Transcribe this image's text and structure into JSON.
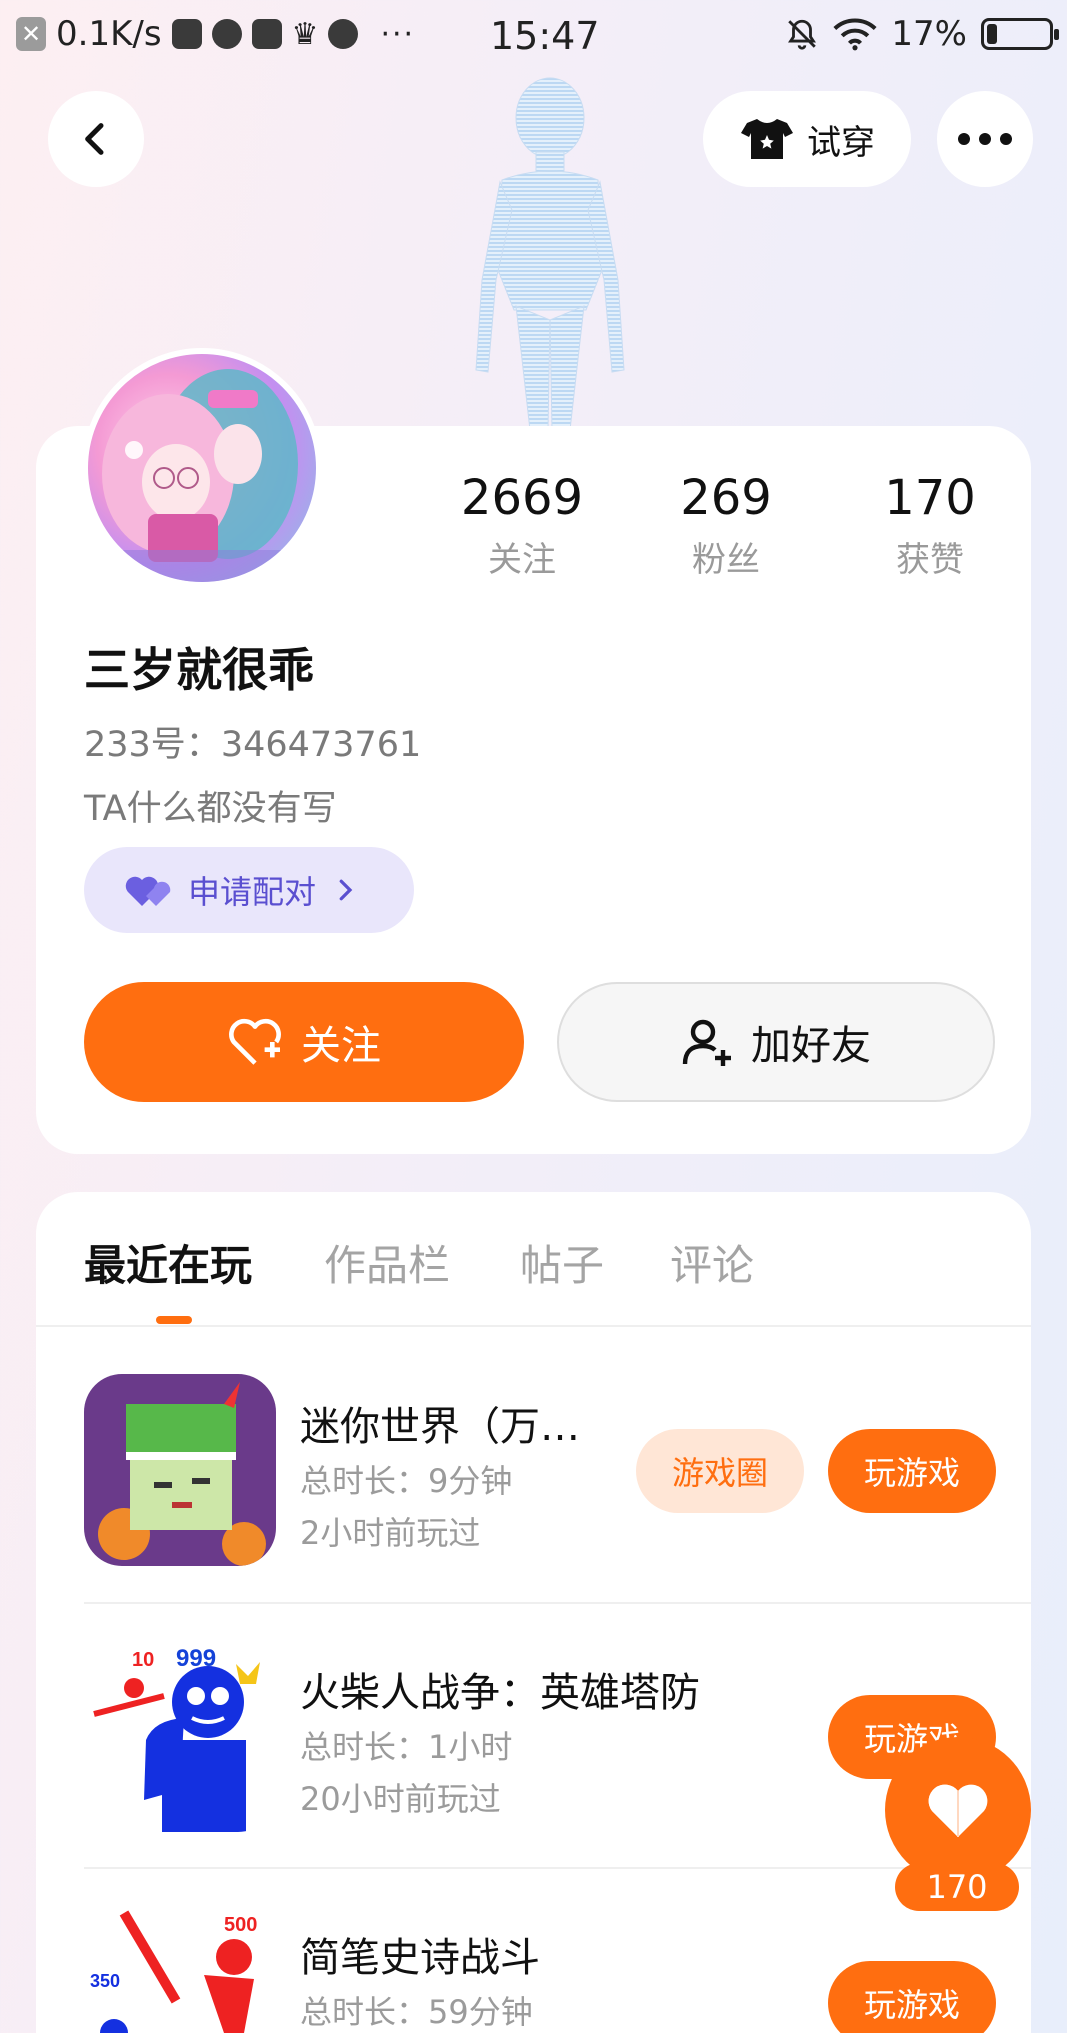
{
  "status_bar": {
    "speed": "0.1K/s",
    "time": "15:47",
    "battery": "17%",
    "battery_level": 0.17
  },
  "top_nav": {
    "try_on_label": "试穿"
  },
  "profile": {
    "username": "三岁就很乖",
    "uid_label": "233号：",
    "uid": "346473761",
    "bio": "TA什么都没有写",
    "pair_label": "申请配对",
    "stats": [
      {
        "value": "2669",
        "label": "关注"
      },
      {
        "value": "269",
        "label": "粉丝"
      },
      {
        "value": "170",
        "label": "获赞"
      }
    ],
    "follow_label": "关注",
    "add_friend_label": "加好友"
  },
  "tabs": [
    "最近在玩",
    "作品栏",
    "帖子",
    "评论"
  ],
  "games": [
    {
      "name": "迷你世界（万…",
      "duration": "总时长：9分钟",
      "last_played": "2小时前玩过",
      "circle_label": "游戏圈",
      "play_label": "玩游戏"
    },
    {
      "name": "火柴人战争：英雄塔防",
      "duration": "总时长：1小时",
      "last_played": "20小时前玩过",
      "play_label": "玩游戏"
    },
    {
      "name": "简笔史诗战斗",
      "duration": "总时长：59分钟",
      "last_played": "",
      "play_label": "玩游戏"
    }
  ],
  "game_icon_labels": {
    "stick_war_top": "10",
    "stick_war_score": "999",
    "stick_epic_left": "350",
    "stick_epic_right": "500"
  },
  "like_fab": {
    "count": "170"
  },
  "colors": {
    "accent": "#ff6e10",
    "pair_bg": "#e9e6fb",
    "pair_text": "#5a4fd0"
  }
}
